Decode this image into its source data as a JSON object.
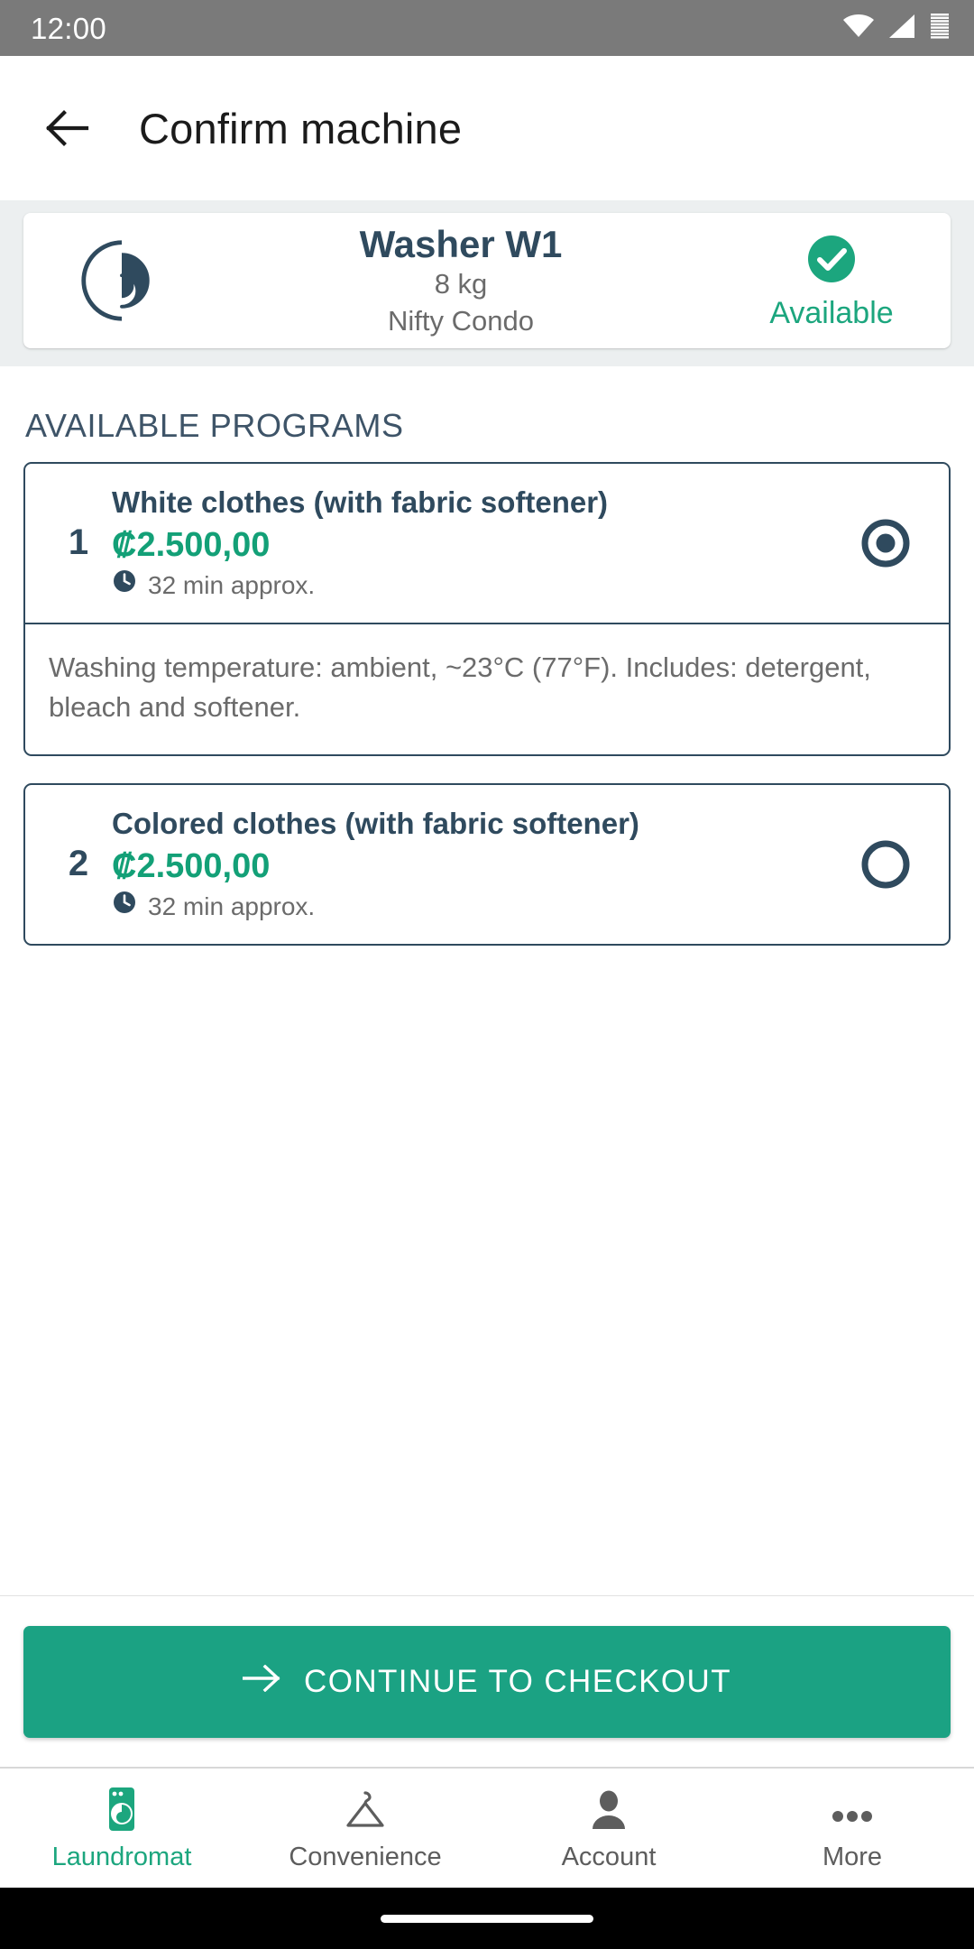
{
  "status_bar": {
    "time": "12:00",
    "icons": [
      "wifi-icon",
      "cellular-signal-icon",
      "battery-icon"
    ]
  },
  "app_bar": {
    "back_icon": "arrow-left-icon",
    "title": "Confirm machine"
  },
  "machine": {
    "icon": "washer-vortex-icon",
    "name": "Washer W1",
    "capacity": "8 kg",
    "location": "Nifty Condo",
    "status_icon": "check-circle-icon",
    "status_label": "Available",
    "status_color": "#1ca67e"
  },
  "programs_section": {
    "title": "AVAILABLE PROGRAMS",
    "items": [
      {
        "index": "1",
        "name": "White clothes (with fabric softener)",
        "price": "₡2.500,00",
        "time_icon": "clock-icon",
        "time": "32 min approx.",
        "selected": true,
        "description": "Washing temperature: ambient, ~23°C (77°F). Includes: detergent, bleach and softener."
      },
      {
        "index": "2",
        "name": "Colored clothes (with fabric softener)",
        "price": "₡2.500,00",
        "time_icon": "clock-icon",
        "time": "32 min approx.",
        "selected": false,
        "description": ""
      }
    ]
  },
  "cta": {
    "icon": "arrow-right-icon",
    "label": "CONTINUE TO CHECKOUT",
    "color": "#1ba283"
  },
  "bottom_nav": {
    "items": [
      {
        "label": "Laundromat",
        "icon": "washing-machine-icon",
        "active": true
      },
      {
        "label": "Convenience",
        "icon": "hanger-icon",
        "active": false
      },
      {
        "label": "Account",
        "icon": "person-icon",
        "active": false
      },
      {
        "label": "More",
        "icon": "ellipsis-icon",
        "active": false
      }
    ]
  },
  "theme": {
    "accent_green": "#1ba283",
    "slate": "#2f4a5e",
    "price_green": "#13a077",
    "status_bar_bg": "#7a7a7a",
    "section_bg": "#eceff0"
  }
}
